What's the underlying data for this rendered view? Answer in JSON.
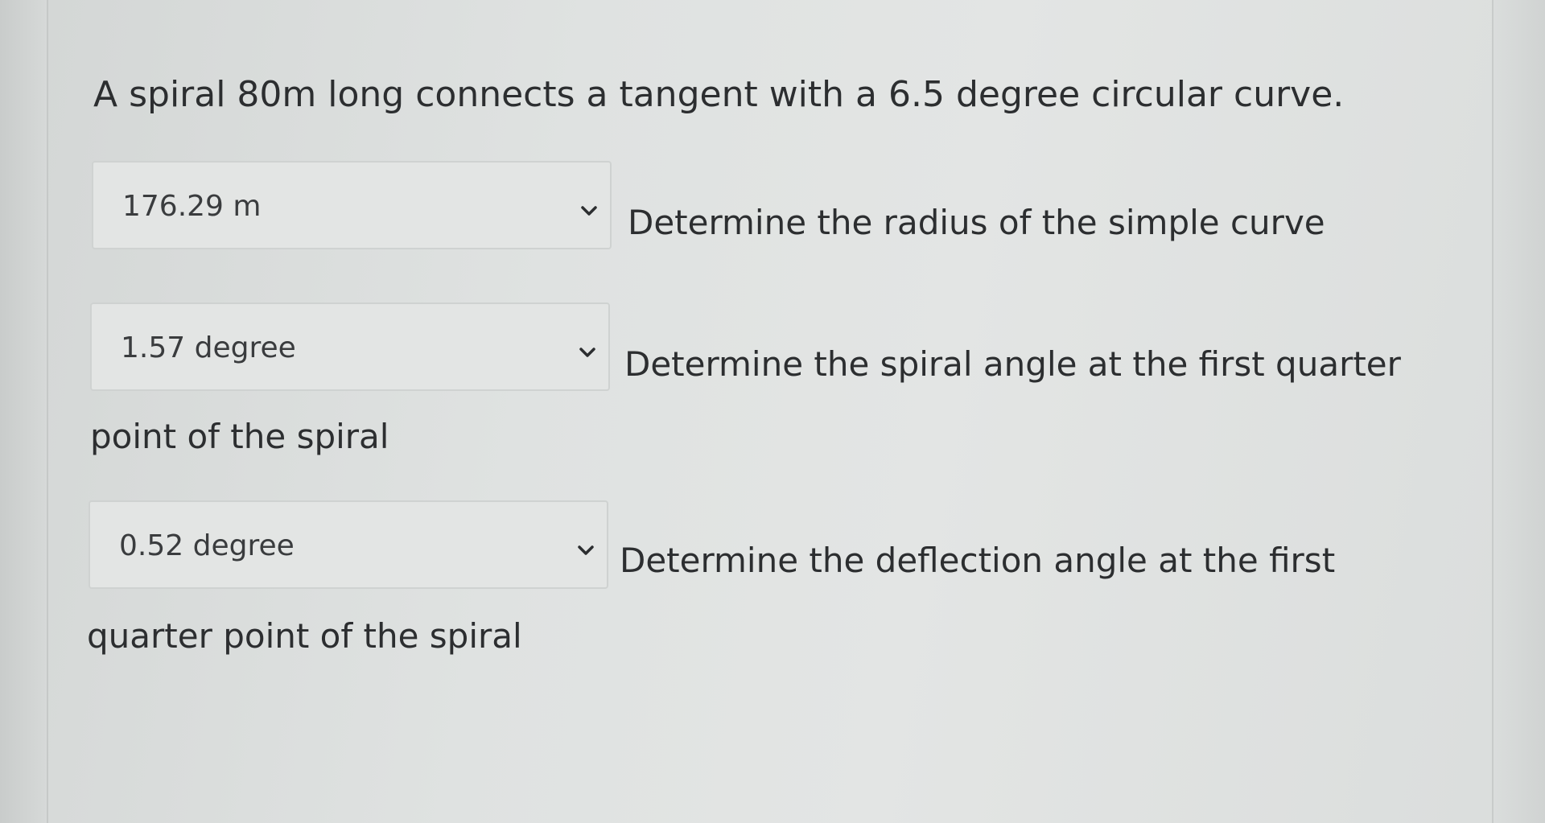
{
  "question": {
    "text": "A spiral 80m long connects a tangent with a 6.5 degree circular curve."
  },
  "items": [
    {
      "selected_value": "176.29 m",
      "prompt": "Determine the radius of the simple curve",
      "continuation": ""
    },
    {
      "selected_value": "1.57 degree",
      "prompt": "Determine the spiral angle at the first quarter",
      "continuation": "point of the spiral"
    },
    {
      "selected_value": "0.52 degree",
      "prompt": "Determine the deflection angle at the first",
      "continuation": "quarter point of the spiral"
    }
  ],
  "icons": {
    "dropdown": "chevron-down-icon"
  }
}
